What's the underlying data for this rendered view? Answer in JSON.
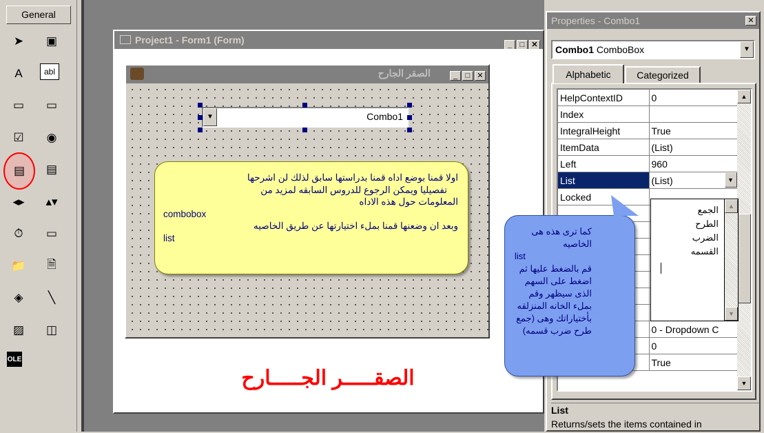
{
  "toolbox": {
    "title": "General",
    "tools": [
      {
        "id": "pointer",
        "glyph": "➤"
      },
      {
        "id": "picturebox",
        "glyph": "▣"
      },
      {
        "id": "label",
        "glyph": "A"
      },
      {
        "id": "textbox",
        "glyph": "abl"
      },
      {
        "id": "frame",
        "glyph": "▭"
      },
      {
        "id": "commandbutton",
        "glyph": "▭"
      },
      {
        "id": "checkbox",
        "glyph": "☑"
      },
      {
        "id": "optionbutton",
        "glyph": "◉"
      },
      {
        "id": "combobox",
        "glyph": "▤"
      },
      {
        "id": "listbox",
        "glyph": "▤"
      },
      {
        "id": "hscrollbar",
        "glyph": "◂▸"
      },
      {
        "id": "vscrollbar",
        "glyph": "▴▾"
      },
      {
        "id": "timer",
        "glyph": "⏱"
      },
      {
        "id": "drivelistbox",
        "glyph": "▭"
      },
      {
        "id": "dirlistbox",
        "glyph": "📁"
      },
      {
        "id": "filelistbox",
        "glyph": "🗎"
      },
      {
        "id": "shape",
        "glyph": "◈"
      },
      {
        "id": "line",
        "glyph": "╲"
      },
      {
        "id": "image",
        "glyph": "▨"
      },
      {
        "id": "data",
        "glyph": "◫"
      },
      {
        "id": "ole",
        "glyph": "OLE"
      }
    ]
  },
  "designer": {
    "title": "Project1 - Form1 (Form)",
    "form_title": "الصقر الجارح",
    "combo_text": "Combo1"
  },
  "callout_yellow": {
    "lines": [
      "اولا قمنا بوضع اداه قمنا بدراستها سابق لذلك لن اشرحها",
      "تفصيليا ويمكن الرجوع للدروس السابقه لمزيد من",
      "المعلومات حول هذه الاداه",
      "combobox",
      "وبعد ان وضعنها قمنا بملء اختيارتها عن طريق الخاصيه",
      "list"
    ]
  },
  "callout_blue": {
    "lines": [
      "كما ترى هذه هى",
      "الخاصيه",
      "list",
      "قم بالضغط عليها ثم",
      "اضغط على السهم",
      "الذى سيظهر وقم",
      "بملء الخانه المنزلقه",
      "بأختياراتك وهى (جمع",
      "طرح ضرب قسمه)"
    ]
  },
  "bottom_caption": "الصقـــــر الجـــــارح",
  "properties": {
    "title": "Properties - Combo1",
    "object_name": "Combo1",
    "object_type": "ComboBox",
    "tabs": [
      "Alphabetic",
      "Categorized"
    ],
    "rows": [
      {
        "name": "HelpContextID",
        "value": "0"
      },
      {
        "name": "Index",
        "value": ""
      },
      {
        "name": "IntegralHeight",
        "value": "True"
      },
      {
        "name": "ItemData",
        "value": "(List)"
      },
      {
        "name": "Left",
        "value": "960"
      },
      {
        "name": "List",
        "value": "(List)"
      },
      {
        "name": "Locked",
        "value": ""
      },
      {
        "name": "",
        "value": ""
      },
      {
        "name": "",
        "value": ""
      },
      {
        "name": "",
        "value": ""
      },
      {
        "name": "",
        "value": ""
      },
      {
        "name": "",
        "value": ""
      },
      {
        "name": "",
        "value": ""
      },
      {
        "name": "",
        "value": "False"
      },
      {
        "name": "",
        "value": "0 - Dropdown C"
      },
      {
        "name": "",
        "value": "0"
      },
      {
        "name": "",
        "value": "True"
      }
    ],
    "list_items": [
      "الجمع",
      "الطرح",
      "الضرب",
      "القسمه"
    ],
    "desc_title": "List",
    "desc_text": "Returns/sets the items contained in"
  },
  "colors": {
    "title_active": "#0a246a",
    "title_inactive": "#808080",
    "selection": "#0a246a",
    "caption_red": "#ff0000",
    "callout_yellow": "#ffff99",
    "callout_blue": "#7d9ff0"
  }
}
